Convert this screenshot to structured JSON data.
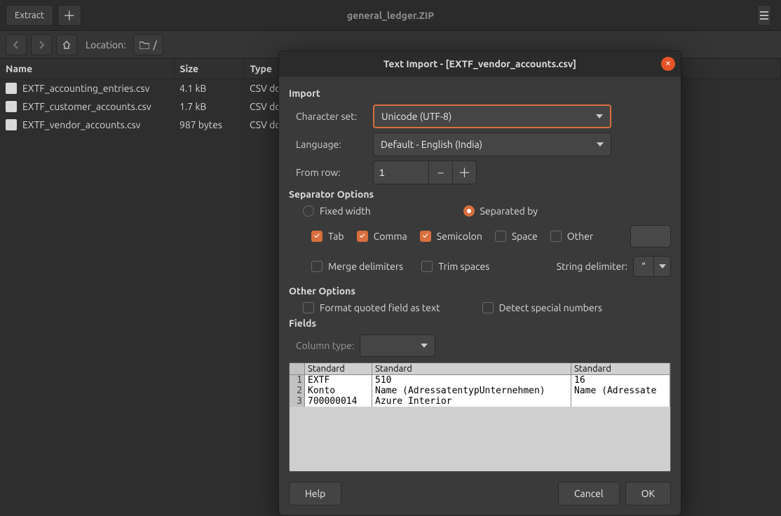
{
  "window": {
    "title": "general_ledger.ZIP",
    "extract_label": "Extract",
    "location_label": "Location:",
    "path": "/"
  },
  "columns": {
    "name": "Name",
    "size": "Size",
    "type": "Type"
  },
  "files": [
    {
      "name": "EXTF_accounting_entries.csv",
      "size": "4.1 kB",
      "type": "CSV do"
    },
    {
      "name": "EXTF_customer_accounts.csv",
      "size": "1.7 kB",
      "type": "CSV do"
    },
    {
      "name": "EXTF_vendor_accounts.csv",
      "size": "987 bytes",
      "type": "CSV do"
    }
  ],
  "dialog": {
    "title": "Text Import - [EXTF_vendor_accounts.csv]",
    "sections": {
      "import": "Import",
      "separator": "Separator Options",
      "other": "Other Options",
      "fields": "Fields"
    },
    "labels": {
      "charset": "Character set:",
      "language": "Language:",
      "from_row": "From row:",
      "fixed_width": "Fixed width",
      "separated_by": "Separated by",
      "tab": "Tab",
      "comma": "Comma",
      "semicolon": "Semicolon",
      "space": "Space",
      "other_sep": "Other",
      "merge": "Merge delimiters",
      "trim": "Trim spaces",
      "string_delim": "String delimiter:",
      "format_quoted": "Format quoted field as text",
      "detect_special": "Detect special numbers",
      "column_type": "Column type:",
      "std": "Standard"
    },
    "values": {
      "charset": "Unicode (UTF-8)",
      "language": "Default - English (India)",
      "from_row": "1",
      "string_delim": "\""
    },
    "buttons": {
      "help": "Help",
      "cancel": "Cancel",
      "ok": "OK"
    },
    "preview": {
      "rows": [
        {
          "n": "1",
          "c1": "EXTF",
          "c2": "510",
          "c3": "16"
        },
        {
          "n": "2",
          "c1": "Konto",
          "c2": "Name (AdressatentypUnternehmen)",
          "c3": "Name (Adressate"
        },
        {
          "n": "3",
          "c1": "700000014",
          "c2": "Azure Interior",
          "c3": ""
        }
      ]
    }
  }
}
